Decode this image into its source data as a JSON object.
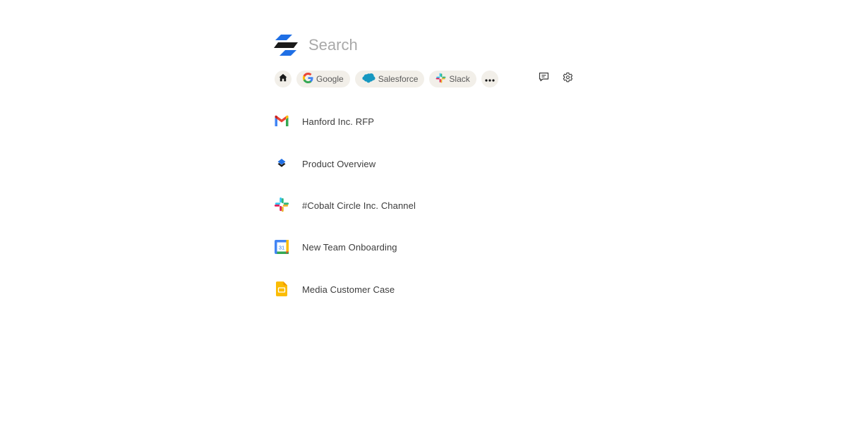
{
  "search": {
    "placeholder": "Search",
    "value": ""
  },
  "filters": {
    "home_icon": "home-icon",
    "chips": [
      {
        "label": "Google",
        "icon": "google-icon"
      },
      {
        "label": "Salesforce",
        "icon": "salesforce-icon"
      },
      {
        "label": "Slack",
        "icon": "slack-icon"
      }
    ],
    "more_icon": "more-icon"
  },
  "toolbar": {
    "feedback_icon": "feedback-icon",
    "settings_icon": "gear-icon"
  },
  "results": [
    {
      "label": "Hanford Inc. RFP",
      "icon": "gmail-icon"
    },
    {
      "label": "Product Overview",
      "icon": "dropbox-paper-icon"
    },
    {
      "label": "#Cobalt Circle Inc. Channel",
      "icon": "slack-icon"
    },
    {
      "label": "New Team Onboarding",
      "icon": "google-calendar-icon",
      "icon_text": "31"
    },
    {
      "label": "Media Customer Case",
      "icon": "google-slides-icon"
    }
  ],
  "colors": {
    "chip_background": "#f2efe9",
    "brand_blue": "#1f6fe5",
    "brand_dark": "#1a1a1a",
    "placeholder": "#a9a9a9"
  }
}
